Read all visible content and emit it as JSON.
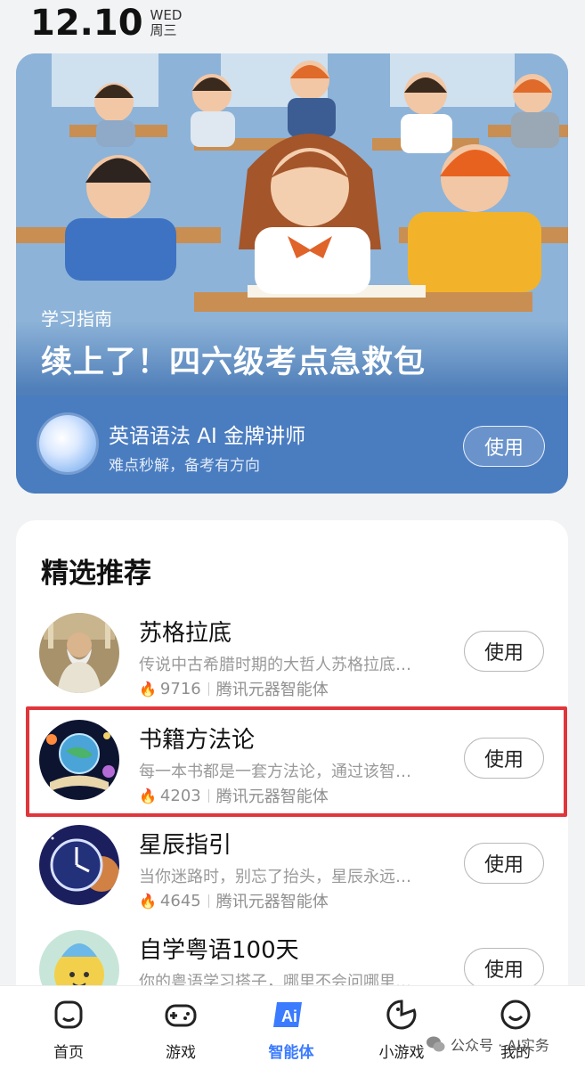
{
  "status": {
    "date": "12.10",
    "weekday_en": "WED",
    "weekday_cn": "周三"
  },
  "hero": {
    "tag": "学习指南",
    "title": "续上了！四六级考点急救包",
    "agent_name": "英语语法 AI 金牌讲师",
    "agent_desc": "难点秒解，备考有方向",
    "use_label": "使用"
  },
  "featured": {
    "title": "精选推荐",
    "items": [
      {
        "name": "苏格拉底",
        "desc": "传说中古希腊时期的大哲人苏格拉底…",
        "count": "9716",
        "source": "腾讯元器智能体",
        "use_label": "使用"
      },
      {
        "name": "书籍方法论",
        "desc": "每一本书都是一套方法论，通过该智…",
        "count": "4203",
        "source": "腾讯元器智能体",
        "use_label": "使用"
      },
      {
        "name": "星辰指引",
        "desc": "当你迷路时，别忘了抬头，星辰永远…",
        "count": "4645",
        "source": "腾讯元器智能体",
        "use_label": "使用"
      },
      {
        "name": "自学粤语100天",
        "desc": "你的粤语学习搭子，哪里不会问哪里…",
        "count": "",
        "source": "",
        "use_label": "使用"
      }
    ]
  },
  "nav": {
    "items": [
      {
        "label": "首页",
        "icon": "home-icon"
      },
      {
        "label": "游戏",
        "icon": "gamepad-icon"
      },
      {
        "label": "智能体",
        "icon": "ai-agent-icon"
      },
      {
        "label": "小游戏",
        "icon": "mini-game-icon"
      },
      {
        "label": "我的",
        "icon": "profile-icon"
      }
    ],
    "active": "智能体"
  },
  "watermark": {
    "text": "公众号 · AI实务"
  },
  "colors": {
    "accent": "#3b7bff",
    "highlight": "#e0363b",
    "fire": "#ff6a2b",
    "hero_blue": "#4a7cc0"
  }
}
